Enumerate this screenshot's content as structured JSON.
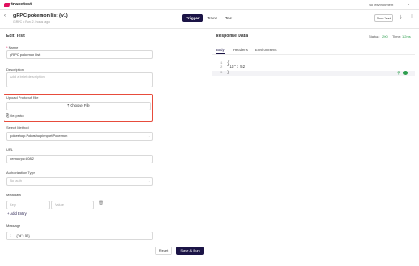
{
  "app": {
    "name": "tracetest",
    "environment": "No environment"
  },
  "header": {
    "title": "gRPC pokemon list (v1)",
    "subtitle": "GRPC • Run 21 hours ago",
    "tabs": [
      {
        "label": "Trigger"
      },
      {
        "label": "Trace"
      },
      {
        "label": "Test"
      }
    ],
    "run_button": "Run Test"
  },
  "edit": {
    "section_title": "Edit Test",
    "name": {
      "label": "Name",
      "value": "gRPC pokemon list"
    },
    "description": {
      "label": "Description",
      "placeholder": "Add a brief description"
    },
    "upload": {
      "label": "Upload Protobuf File",
      "button": "Choose File",
      "file_name": "file.proto"
    },
    "select_method": {
      "label": "Select Method",
      "value": "pokeshop.Pokeshop.importPokemon"
    },
    "url": {
      "label": "URL",
      "value": "demo-rpc:8082"
    },
    "auth": {
      "label": "Authorization Type",
      "value": "No auth"
    },
    "metadata": {
      "label": "Metadata",
      "key_placeholder": "Key",
      "value_placeholder": "Value",
      "add_entry": "Add Entry"
    },
    "message": {
      "label": "Message",
      "line_number": "1",
      "value": "{\"id\": 52}"
    },
    "reset_button": "Reset",
    "save_button": "Save & Run"
  },
  "response": {
    "section_title": "Response Data",
    "status_label": "Status:",
    "status_value": "200",
    "time_label": "Time:",
    "time_value": "12ms",
    "tabs": [
      {
        "label": "Body"
      },
      {
        "label": "Headers"
      },
      {
        "label": "Environment"
      }
    ],
    "body": {
      "lines": [
        {
          "num": "1",
          "text": "{"
        },
        {
          "num": "2",
          "text": "\"id\": 52"
        },
        {
          "num": "3",
          "text": "}"
        }
      ]
    }
  },
  "colors": {
    "brand": "#e0115f",
    "primary": "#1b1446",
    "highlight": "#e74c3c",
    "success": "#2e9e4e"
  }
}
